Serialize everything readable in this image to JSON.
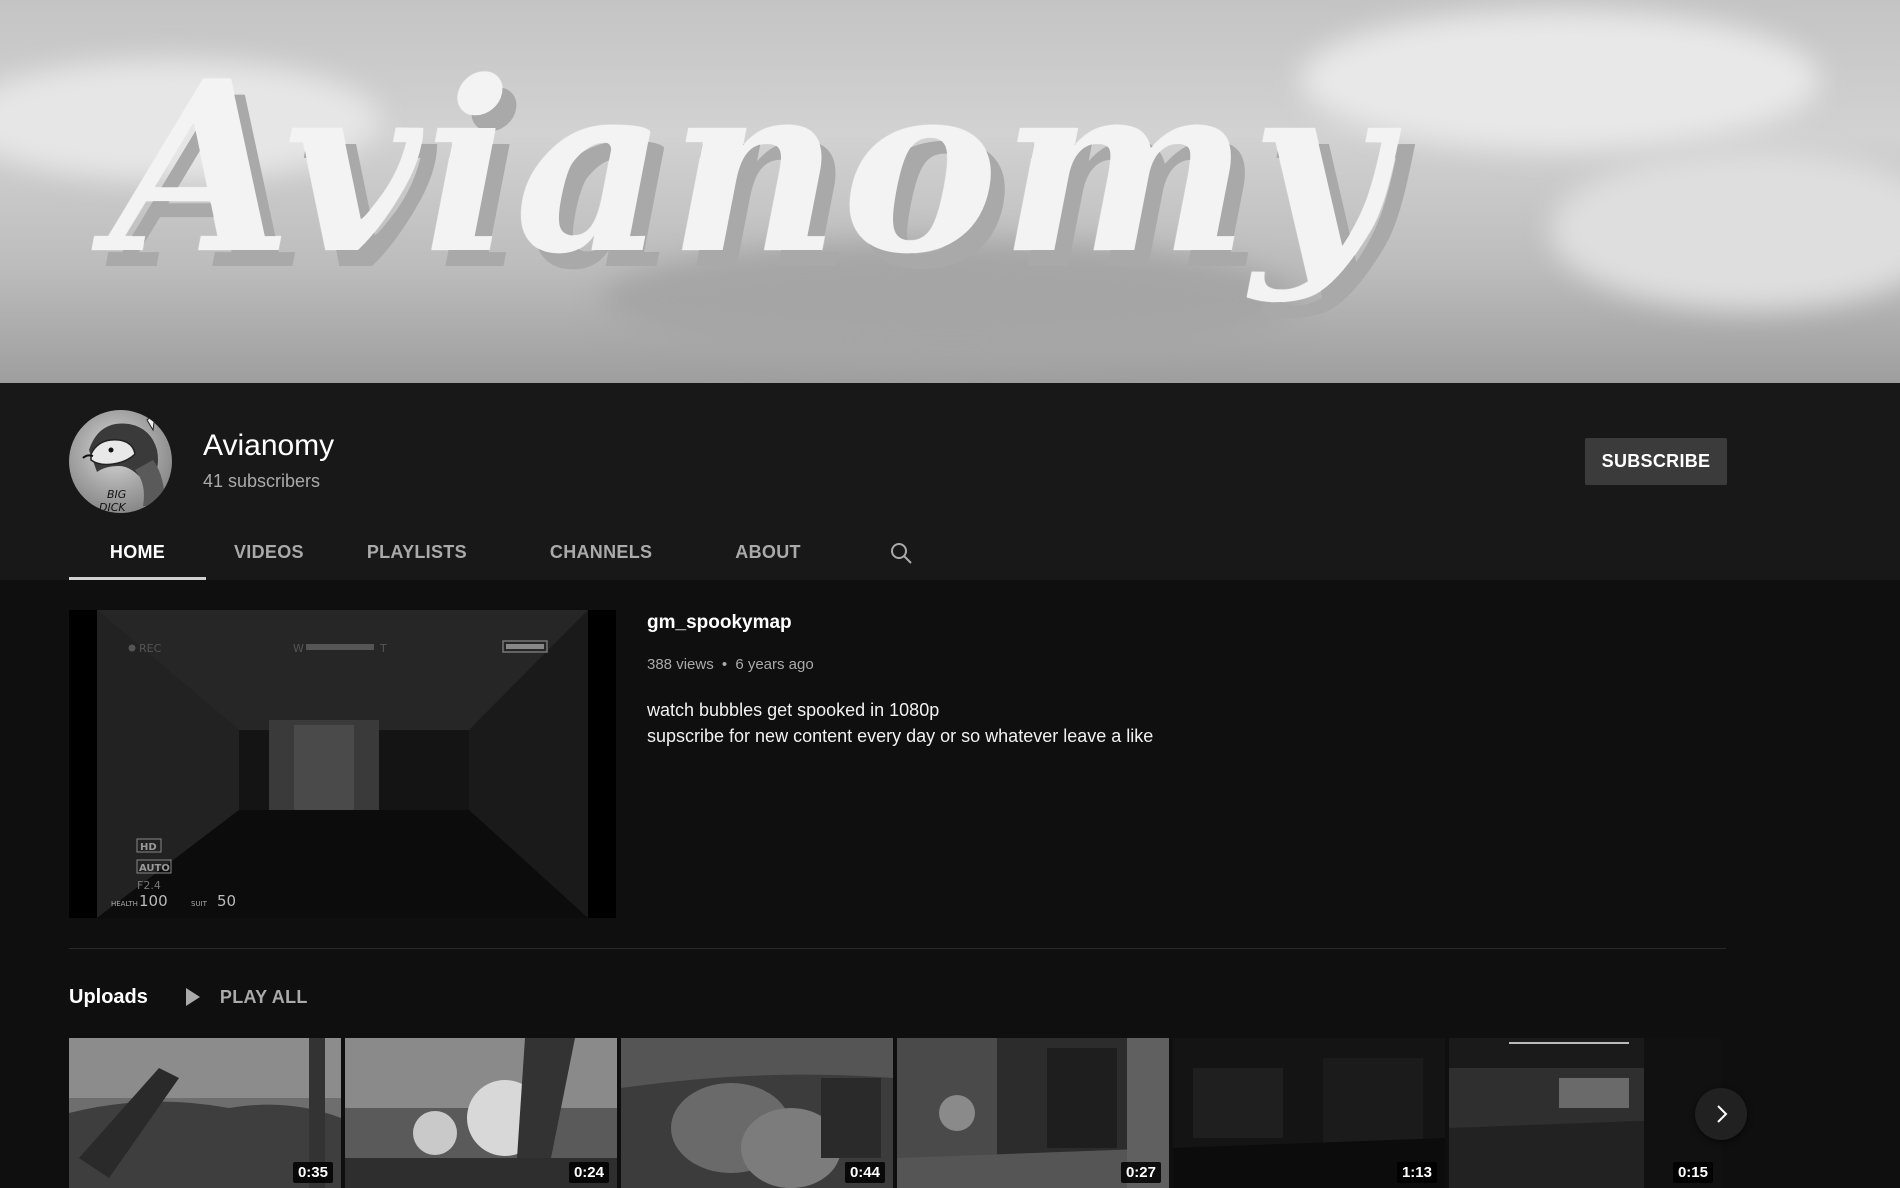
{
  "banner": {
    "title": "Avianomy"
  },
  "channel": {
    "name": "Avianomy",
    "subscribers": "41 subscribers",
    "subscribe_label": "SUBSCRIBE",
    "avatar_text_1": "BIG",
    "avatar_text_2": "DICK"
  },
  "tabs": [
    {
      "label": "HOME",
      "active": true
    },
    {
      "label": "VIDEOS",
      "active": false
    },
    {
      "label": "PLAYLISTS",
      "active": false
    },
    {
      "label": "CHANNELS",
      "active": false
    },
    {
      "label": "ABOUT",
      "active": false
    }
  ],
  "search_icon": "search-icon",
  "featured": {
    "title": "gm_spookymap",
    "views": "388 views",
    "separator": "•",
    "age": "6 years ago",
    "description_line1": "watch bubbles get spooked in 1080p",
    "description_line2": "supscribe for new content every day or so whatever leave a like",
    "hud": {
      "rec": "REC",
      "w": "W",
      "t": "T",
      "hd": "HD",
      "auto": "AUTO",
      "aperture": "F2.4",
      "health_label": "HEALTH",
      "health_value": "100",
      "suit_label": "SUIT",
      "suit_value": "50"
    }
  },
  "uploads": {
    "title": "Uploads",
    "play_all_label": "PLAY ALL",
    "videos": [
      {
        "duration": "0:35"
      },
      {
        "duration": "0:24"
      },
      {
        "duration": "0:44"
      },
      {
        "duration": "0:27"
      },
      {
        "duration": "1:13"
      },
      {
        "duration": "0:15"
      }
    ]
  },
  "colors": {
    "background": "#0f0f0f",
    "header": "#181818",
    "subscribe": "#3b3b3b",
    "muted_text": "#aaaaaa"
  }
}
